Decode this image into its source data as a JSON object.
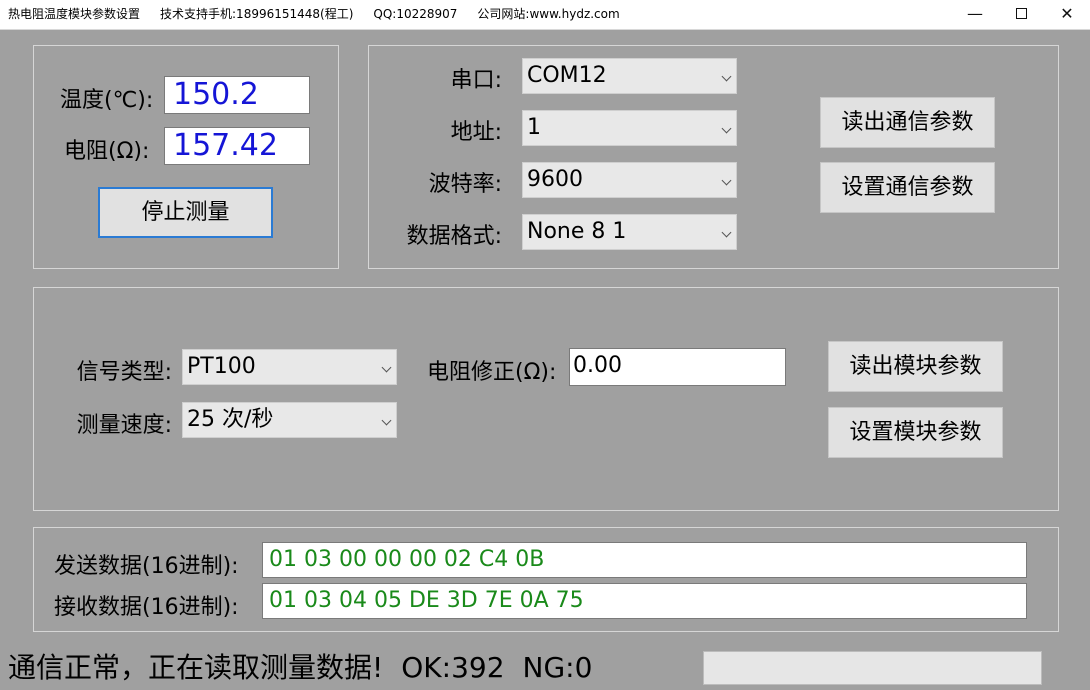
{
  "window": {
    "title": "热电阻温度模块参数设置",
    "support": "技术支持手机:18996151448(程工)",
    "qq": "QQ:10228907",
    "website": "公司网站:www.hydz.com",
    "min_glyph": "—",
    "close_glyph": "✕"
  },
  "measure": {
    "temp_label": "温度(℃):",
    "temp_value": "150.2",
    "res_label": "电阻(Ω):",
    "res_value": "157.42",
    "stop_button": "停止测量"
  },
  "comm": {
    "port_label": "串口:",
    "port_value": "COM12",
    "addr_label": "地址:",
    "addr_value": "1",
    "baud_label": "波特率:",
    "baud_value": "9600",
    "format_label": "数据格式:",
    "format_value": "None 8 1",
    "read_button": "读出通信参数",
    "set_button": "设置通信参数"
  },
  "module": {
    "signal_label": "信号类型:",
    "signal_value": "PT100",
    "speed_label": "测量速度:",
    "speed_value": "25 次/秒",
    "correction_label": "电阻修正(Ω):",
    "correction_value": "0.00",
    "read_button": "读出模块参数",
    "set_button": "设置模块参数"
  },
  "data": {
    "send_label": "发送数据(16进制):",
    "send_value": "01 03 00 00 00 02 C4 0B",
    "recv_label": "接收数据(16进制):",
    "recv_value": "01 03 04 05 DE 3D 7E 0A 75"
  },
  "status": {
    "message": "通信正常，正在读取测量数据!",
    "ok": "OK:392",
    "ng": "NG:0",
    "progress": 0
  },
  "colors": {
    "window_bg": "#a0a0a0",
    "value_blue": "#1515d6",
    "hex_green": "#1a8a1a",
    "focus_border": "#2a7bd4"
  }
}
